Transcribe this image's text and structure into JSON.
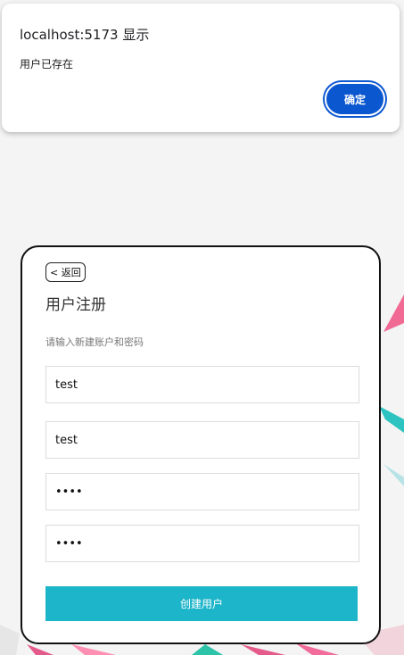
{
  "alert": {
    "title": "localhost:5173 显示",
    "message": "用户已存在",
    "ok_label": "确定"
  },
  "register": {
    "back_label": "< 返回",
    "title": "用户注册",
    "subtitle": "请输入新建账户和密码",
    "fields": [
      {
        "value": "test",
        "type": "text"
      },
      {
        "value": "test",
        "type": "text"
      },
      {
        "value": "test",
        "type": "password"
      },
      {
        "value": "test",
        "type": "password"
      }
    ],
    "submit_label": "创建用户"
  },
  "colors": {
    "accent": "#1db5c9",
    "dialog_button": "#0b57d0",
    "card_border": "#111111"
  }
}
